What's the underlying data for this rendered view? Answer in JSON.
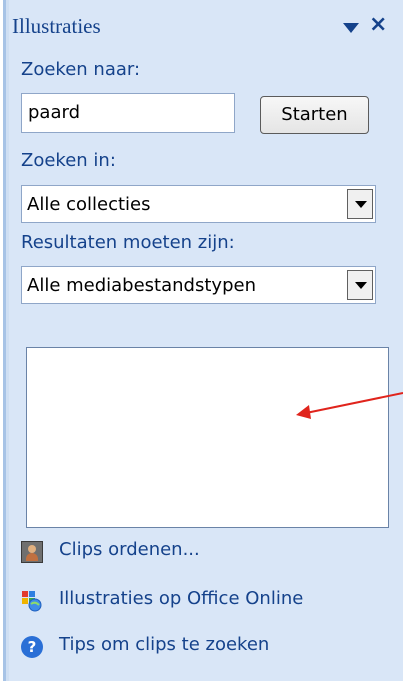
{
  "pane": {
    "title": "Illustraties",
    "close_glyph": "×"
  },
  "search": {
    "label": "Zoeken naar:",
    "value": "paard",
    "button": "Starten"
  },
  "search_in": {
    "label": "Zoeken in:",
    "value": "Alle collecties"
  },
  "results_type": {
    "label": "Resultaten moeten zijn:",
    "value": "Alle mediabestandstypen"
  },
  "links": [
    {
      "label": "Clips ordenen...",
      "icon": "organize-clips-icon"
    },
    {
      "label": "Illustraties op Office Online",
      "icon": "office-online-icon"
    },
    {
      "label": "Tips om clips te zoeken",
      "icon": "help-icon"
    }
  ],
  "colors": {
    "pane_bg": "#d9e6f7",
    "title_text": "#15428b",
    "annotation_arrow": "#e0241c"
  }
}
